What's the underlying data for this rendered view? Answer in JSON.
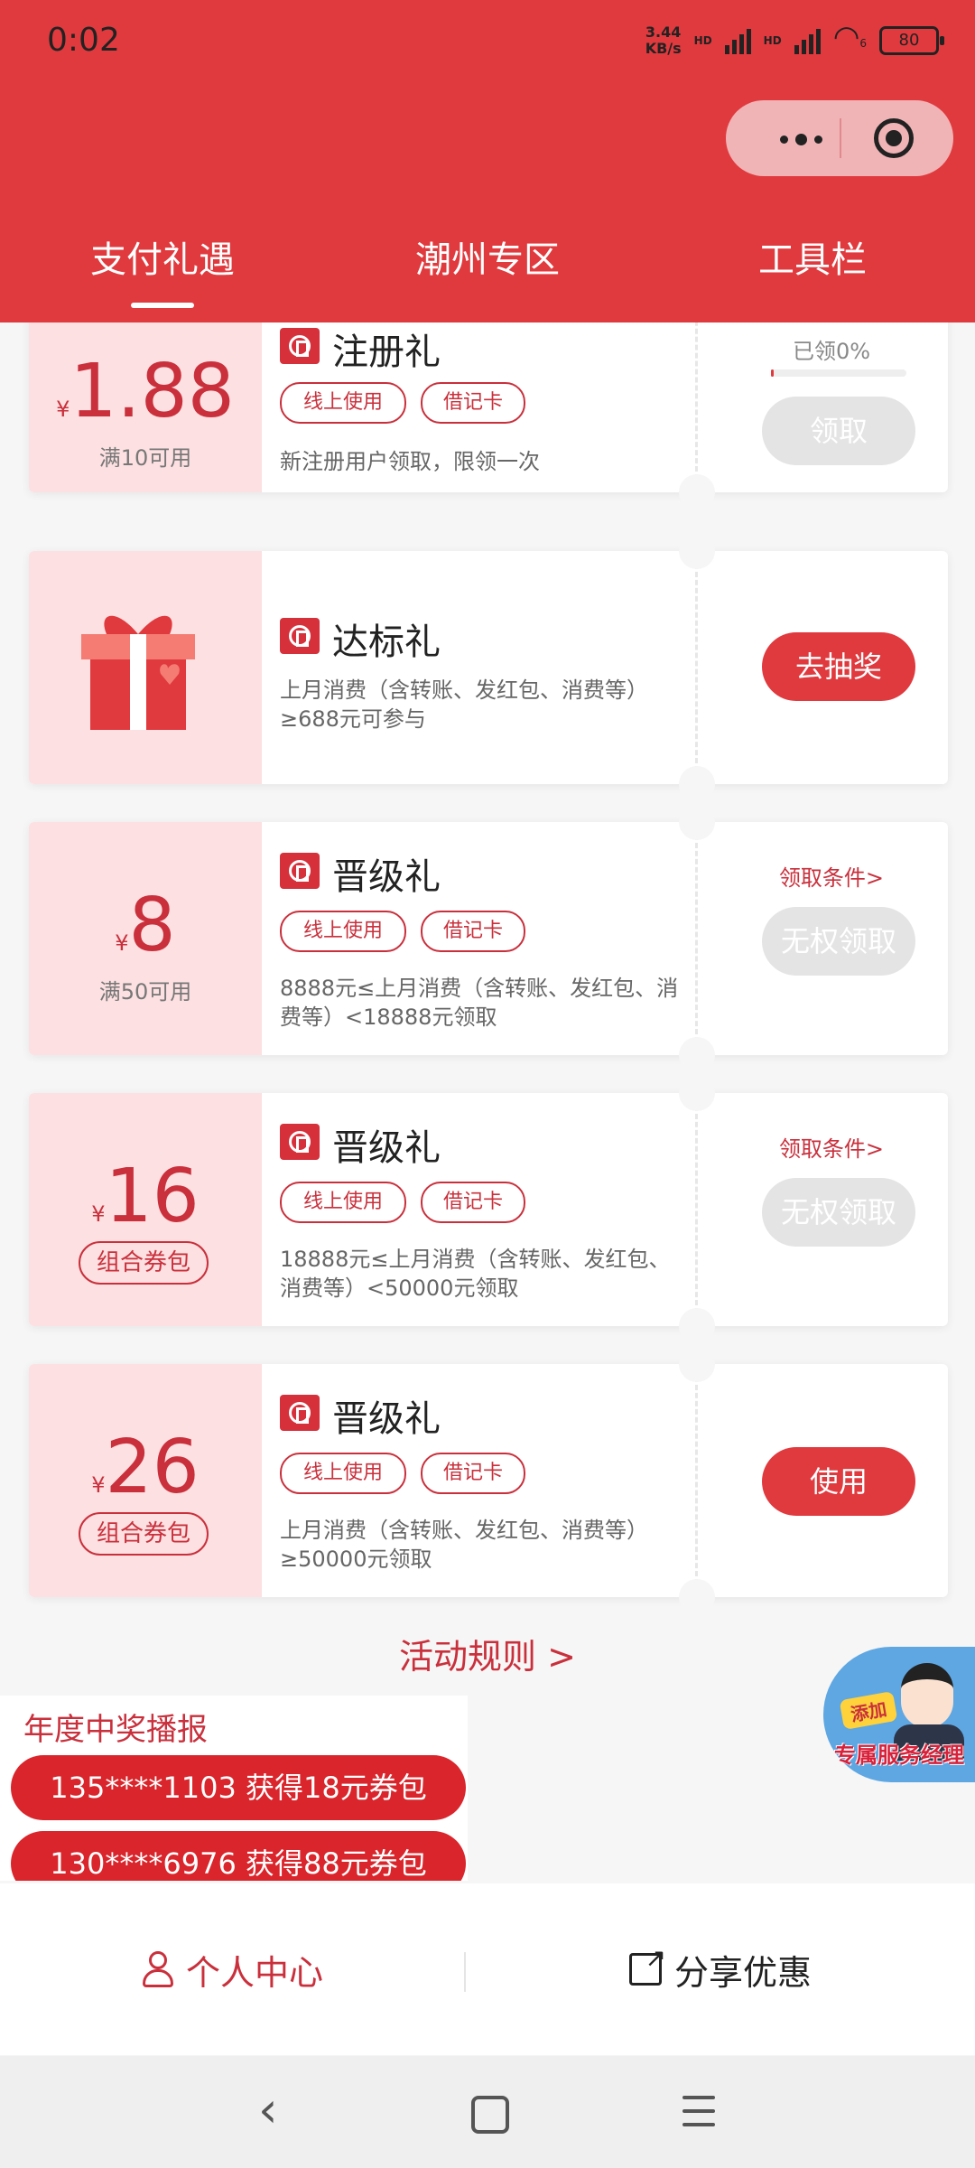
{
  "status": {
    "time": "0:02",
    "speed": "3.44",
    "speed_unit": "KB/s",
    "hd1": "HD",
    "hd2": "HD",
    "battery": "80",
    "wifi_label": "6"
  },
  "tabs": [
    {
      "label": "支付礼遇"
    },
    {
      "label": "潮州专区"
    },
    {
      "label": "工具栏"
    }
  ],
  "cards": [
    {
      "amount": "1.88",
      "yen": "¥",
      "condition": "满10可用",
      "title": "注册礼",
      "tags": [
        "线上使用",
        "借记卡"
      ],
      "desc": "新注册用户领取，限领一次",
      "claimed": "已领0%",
      "claimed_progress": 0,
      "button": "领取"
    },
    {
      "icon": "gift-icon",
      "title": "达标礼",
      "desc": "上月消费（含转账、发红包、消费等）≥688元可参与",
      "button": "去抽奖"
    },
    {
      "amount": "8",
      "yen": "¥",
      "condition": "满50可用",
      "title": "晋级礼",
      "tags": [
        "线上使用",
        "借记卡"
      ],
      "desc": "8888元≤上月消费（含转账、发红包、消费等）<18888元领取",
      "link": "领取条件>",
      "button": "无权领取"
    },
    {
      "amount": "16",
      "yen": "¥",
      "pack": "组合券包",
      "title": "晋级礼",
      "tags": [
        "线上使用",
        "借记卡"
      ],
      "desc": "18888元≤上月消费（含转账、发红包、消费等）<50000元领取",
      "link": "领取条件>",
      "button": "无权领取"
    },
    {
      "amount": "26",
      "yen": "¥",
      "pack": "组合券包",
      "title": "晋级礼",
      "tags": [
        "线上使用",
        "借记卡"
      ],
      "desc": "上月消费（含转账、发红包、消费等）≥50000元领取",
      "button": "使用"
    }
  ],
  "rules": "活动规则 >",
  "winners": {
    "title": "年度中奖播报",
    "items": [
      "135****1103 获得18元券包",
      "130****6976 获得88元券包"
    ]
  },
  "floating": {
    "add": "添加",
    "label": "专属服务经理"
  },
  "bottom": {
    "profile": "个人中心",
    "share": "分享优惠"
  },
  "nav": {
    "back": "‹"
  },
  "colors": {
    "primary": "#e03a3e",
    "accent": "#c9303c",
    "pink": "#fde0e1"
  }
}
